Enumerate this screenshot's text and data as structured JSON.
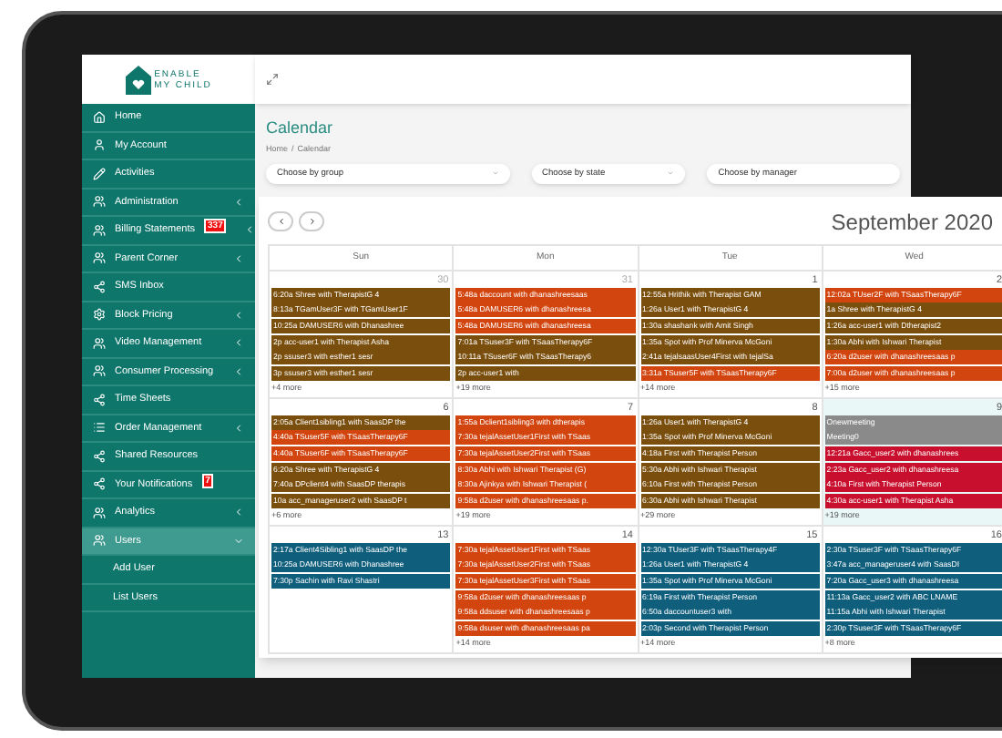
{
  "logo": {
    "line_1": "ENABLE",
    "line_2": "MY CHILD"
  },
  "sidebar": {
    "items": [
      {
        "label": "Home",
        "has_submenu": false,
        "expanded": false,
        "selected": false
      },
      {
        "label": "My Account",
        "has_submenu": false,
        "expanded": false,
        "selected": false
      },
      {
        "label": "Activities",
        "has_submenu": false,
        "expanded": false,
        "selected": false
      },
      {
        "label": "Administration",
        "has_submenu": true,
        "expanded": false,
        "selected": false
      },
      {
        "label": "Billing Statements",
        "badge": "337",
        "has_submenu": true,
        "expanded": false,
        "selected": false
      },
      {
        "label": "Parent Corner",
        "has_submenu": true,
        "expanded": false,
        "selected": false
      },
      {
        "label": "SMS Inbox",
        "has_submenu": false,
        "expanded": false,
        "selected": false
      },
      {
        "label": "Block Pricing",
        "has_submenu": true,
        "expanded": false,
        "selected": false
      },
      {
        "label": "Video Management",
        "has_submenu": true,
        "expanded": false,
        "selected": false
      },
      {
        "label": "Consumer Processing",
        "has_submenu": true,
        "expanded": false,
        "selected": false
      },
      {
        "label": "Time Sheets",
        "has_submenu": false,
        "expanded": false,
        "selected": false
      },
      {
        "label": "Order Management",
        "has_submenu": true,
        "expanded": false,
        "selected": false
      },
      {
        "label": "Shared Resources",
        "has_submenu": false,
        "expanded": false,
        "selected": false
      },
      {
        "label": "Your Notifications",
        "badge": "7",
        "has_submenu": false,
        "expanded": false,
        "selected": false
      },
      {
        "label": "Analytics",
        "has_submenu": true,
        "expanded": false,
        "selected": false
      },
      {
        "label": "Users",
        "has_submenu": true,
        "expanded": true,
        "selected": true,
        "children": [
          {
            "label": "Add User",
            "selected": false
          },
          {
            "label": "List Users",
            "selected": false
          }
        ]
      }
    ]
  },
  "page": {
    "title": "Calendar",
    "breadcrumb": [
      {
        "label": "Home"
      },
      {
        "label": "Calendar"
      }
    ],
    "breadcrumb_separator": "/"
  },
  "filters": [
    {
      "label": "Choose by group"
    },
    {
      "label": "Choose by state"
    },
    {
      "label": "Choose by manager"
    }
  ],
  "calendar": {
    "title": "September 2020",
    "weekdays": [
      "Sun",
      "Mon",
      "Tue",
      "Wed"
    ],
    "weeks": [
      {
        "days": [
          {
            "date": "30",
            "other_month": true,
            "today": false,
            "more": "+4 more",
            "events": [
              {
                "text": "6:20a Shree with TherapistG 4",
                "color": "#7a4e0c"
              },
              {
                "text": "8:13a TGamUser3F with TGamUser1F",
                "color": "#7a4e0c"
              },
              {
                "text": "10:25a DAMUSER6 with Dhanashree",
                "color": "#7a4e0c"
              },
              {
                "text": "2p acc-user1 with Therapist Asha",
                "color": "#7a4e0c"
              },
              {
                "text": "2p ssuser3 with esther1 sesr",
                "color": "#7a4e0c"
              },
              {
                "text": "3p ssuser3 with esther1 sesr",
                "color": "#7a4e0c"
              }
            ]
          },
          {
            "date": "31",
            "other_month": true,
            "today": false,
            "more": "+19 more",
            "events": [
              {
                "text": "5:48a daccount with dhanashreesaas",
                "color": "#d2450f"
              },
              {
                "text": "5:48a DAMUSER6 with dhanashreesa",
                "color": "#d2450f"
              },
              {
                "text": "5:48a DAMUSER6 with dhanashreesa",
                "color": "#d2450f"
              },
              {
                "text": "7:01a TSuser3F with TSaasTherapy6F",
                "color": "#7a4e0c"
              },
              {
                "text": "10:11a TSuser6F with TSaasTherapy6",
                "color": "#7a4e0c"
              },
              {
                "text": "2p acc-user1 with",
                "color": "#7a4e0c"
              }
            ]
          },
          {
            "date": "1",
            "other_month": false,
            "today": false,
            "more": "+14 more",
            "events": [
              {
                "text": "12:55a Hrithik with Therapist GAM",
                "color": "#7a4e0c"
              },
              {
                "text": "1:26a User1 with TherapistG 4",
                "color": "#7a4e0c"
              },
              {
                "text": "1:30a shashank with Amit Singh",
                "color": "#7a4e0c"
              },
              {
                "text": "1:35a Spot with Prof Minerva McGoni",
                "color": "#7a4e0c"
              },
              {
                "text": "2:41a tejalsaasUser4First with tejalSa",
                "color": "#7a4e0c"
              },
              {
                "text": "3:31a TSuser5F with TSaasTherapy6F",
                "color": "#d2450f"
              }
            ]
          },
          {
            "date": "2",
            "other_month": false,
            "today": false,
            "more": "+15 more",
            "events": [
              {
                "text": "12:02a TUser2F with TSaasTherapy6F",
                "color": "#d2450f"
              },
              {
                "text": "1a Shree with TherapistG 4",
                "color": "#7a4e0c"
              },
              {
                "text": "1:26a acc-user1 with Dtherapist2",
                "color": "#7a4e0c"
              },
              {
                "text": "1:30a Abhi with Ishwari Therapist",
                "color": "#7a4e0c"
              },
              {
                "text": "6:20a d2user with dhanashreesaas p",
                "color": "#d2450f"
              },
              {
                "text": "7:00a d2user with dhanashreesaas p",
                "color": "#d2450f"
              }
            ]
          }
        ]
      },
      {
        "days": [
          {
            "date": "6",
            "other_month": false,
            "today": false,
            "more": "+6 more",
            "events": [
              {
                "text": "2:05a Client1sibling1 with SaasDP the",
                "color": "#7a4e0c"
              },
              {
                "text": "4:40a TSuser5F with TSaasTherapy6F",
                "color": "#d2450f"
              },
              {
                "text": "4:40a TSuser6F with TSaasTherapy6F",
                "color": "#d2450f"
              },
              {
                "text": "6:20a Shree with TherapistG 4",
                "color": "#7a4e0c"
              },
              {
                "text": "7:40a DPclient4 with SaasDP therapis",
                "color": "#7a4e0c"
              },
              {
                "text": "10a acc_manageruser2 with SaasDP t",
                "color": "#7a4e0c"
              }
            ]
          },
          {
            "date": "7",
            "other_month": false,
            "today": false,
            "more": "+19 more",
            "events": [
              {
                "text": "1:55a Dclient1sibling3 with dtherapis",
                "color": "#d2450f"
              },
              {
                "text": "7:30a tejalAssetUser1First with TSaas",
                "color": "#d2450f"
              },
              {
                "text": "7:30a tejalAssetUser2First with TSaas",
                "color": "#d2450f"
              },
              {
                "text": "8:30a Abhi with Ishwari Therapist (G)",
                "color": "#d2450f"
              },
              {
                "text": "8:30a Ajinkya with Ishwari Therapist (",
                "color": "#d2450f"
              },
              {
                "text": "9:58a d2user with dhanashreesaas p.",
                "color": "#d2450f"
              }
            ]
          },
          {
            "date": "8",
            "other_month": false,
            "today": false,
            "more": "+29 more",
            "events": [
              {
                "text": "1:26a User1 with TherapistG 4",
                "color": "#7a4e0c"
              },
              {
                "text": "1:35a Spot with Prof Minerva McGoni",
                "color": "#7a4e0c"
              },
              {
                "text": "4:18a First with Therapist Person",
                "color": "#7a4e0c"
              },
              {
                "text": "5:30a Abhi with Ishwari Therapist",
                "color": "#7a4e0c"
              },
              {
                "text": "6:10a First with Therapist Person",
                "color": "#7a4e0c"
              },
              {
                "text": "6:30a Abhi with Ishwari Therapist",
                "color": "#7a4e0c"
              }
            ]
          },
          {
            "date": "9",
            "other_month": false,
            "today": true,
            "more": "+19 more",
            "events": [
              {
                "text": "Onewmeeting",
                "color": "#8a8a8a"
              },
              {
                "text": "Meeting0",
                "color": "#8a8a8a"
              },
              {
                "text": "12:21a Gacc_user2 with dhanashrees",
                "color": "#c8102e"
              },
              {
                "text": "2:23a Gacc_user2 with dhanashreesa",
                "color": "#c8102e"
              },
              {
                "text": "4:10a First with Therapist Person",
                "color": "#c8102e"
              },
              {
                "text": "4:30a acc-user1 with Therapist Asha",
                "color": "#c8102e"
              }
            ]
          }
        ]
      },
      {
        "days": [
          {
            "date": "13",
            "other_month": false,
            "today": false,
            "events": [
              {
                "text": "2:17a Client4Sibling1 with SaasDP the",
                "color": "#0f5e7c"
              },
              {
                "text": "10:25a DAMUSER6 with Dhanashree",
                "color": "#0f5e7c"
              },
              {
                "text": "7:30p Sachin with Ravi Shastri",
                "color": "#0f5e7c"
              }
            ]
          },
          {
            "date": "14",
            "other_month": false,
            "today": false,
            "more": "+14 more",
            "events": [
              {
                "text": "7:30a tejalAssetUser1First with TSaas",
                "color": "#d2450f"
              },
              {
                "text": "7:30a tejalAssetUser2First with TSaas",
                "color": "#d2450f"
              },
              {
                "text": "7:30a tejalAssetUser3First with TSaas",
                "color": "#d2450f"
              },
              {
                "text": "9:58a d2user with dhanashreesaas p",
                "color": "#d2450f"
              },
              {
                "text": "9:58a ddsuser with dhanashreesaas p",
                "color": "#d2450f"
              },
              {
                "text": "9:58a dsuser with dhanashreesaas pa",
                "color": "#d2450f"
              }
            ]
          },
          {
            "date": "15",
            "other_month": false,
            "today": false,
            "more": "+14 more",
            "events": [
              {
                "text": "12:30a TUser3F with TSaasTherapy4F",
                "color": "#0f5e7c"
              },
              {
                "text": "1:26a User1 with TherapistG 4",
                "color": "#0f5e7c"
              },
              {
                "text": "1:35a Spot with Prof Minerva McGoni",
                "color": "#0f5e7c"
              },
              {
                "text": "6:19a First with Therapist Person",
                "color": "#0f5e7c"
              },
              {
                "text": "6:50a daccountuser3 with",
                "color": "#0f5e7c"
              },
              {
                "text": "2:03p Second with Therapist Person",
                "color": "#0f5e7c"
              }
            ]
          },
          {
            "date": "16",
            "other_month": false,
            "today": false,
            "more": "+8 more",
            "events": [
              {
                "text": "2:30a TSuser3F with TSaasTherapy6F",
                "color": "#0f5e7c"
              },
              {
                "text": "3:47a acc_manageruser4 with SaasDI",
                "color": "#0f5e7c"
              },
              {
                "text": "7:20a Gacc_user3 with dhanashreesa",
                "color": "#0f5e7c"
              },
              {
                "text": "11:13a Gacc_user2 with ABC LNAME",
                "color": "#0f5e7c"
              },
              {
                "text": "11:15a Abhi with Ishwari Therapist",
                "color": "#0f5e7c"
              },
              {
                "text": "2:30p TSuser3F with TSaasTherapy6F",
                "color": "#0f5e7c"
              }
            ]
          }
        ]
      }
    ]
  }
}
